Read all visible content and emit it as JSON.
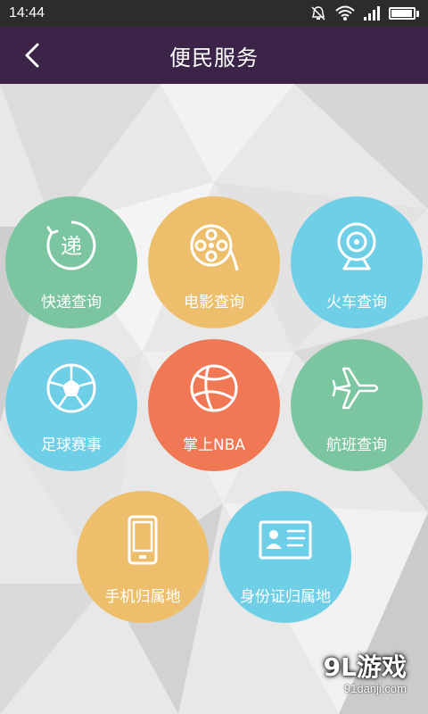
{
  "status_bar": {
    "time": "14:44",
    "battery_level": 0.95
  },
  "header": {
    "title": "便民服务",
    "back_icon": "chevron-left-icon"
  },
  "services": [
    {
      "label": "快递查询",
      "icon": "express-icon",
      "color": "#7bc6a1"
    },
    {
      "label": "电影查询",
      "icon": "film-reel-icon",
      "color": "#edbf6c"
    },
    {
      "label": "火车查询",
      "icon": "camera-icon",
      "color": "#6fcfe6"
    },
    {
      "label": "足球赛事",
      "icon": "soccer-ball-icon",
      "color": "#6fcfe6"
    },
    {
      "label": "掌上NBA",
      "icon": "basketball-icon",
      "color": "#f07855"
    },
    {
      "label": "航班查询",
      "icon": "airplane-icon",
      "color": "#7bc6a1"
    },
    {
      "label": "手机归属地",
      "icon": "phone-icon",
      "color": "#edbf6c"
    },
    {
      "label": "身份证归属地",
      "icon": "id-card-icon",
      "color": "#6fcfe6"
    }
  ],
  "watermark": {
    "brand": "9L游戏",
    "site": "91danji.com"
  },
  "colors": {
    "header_bg": "#3b2447",
    "status_bg": "#2c2c2c"
  }
}
